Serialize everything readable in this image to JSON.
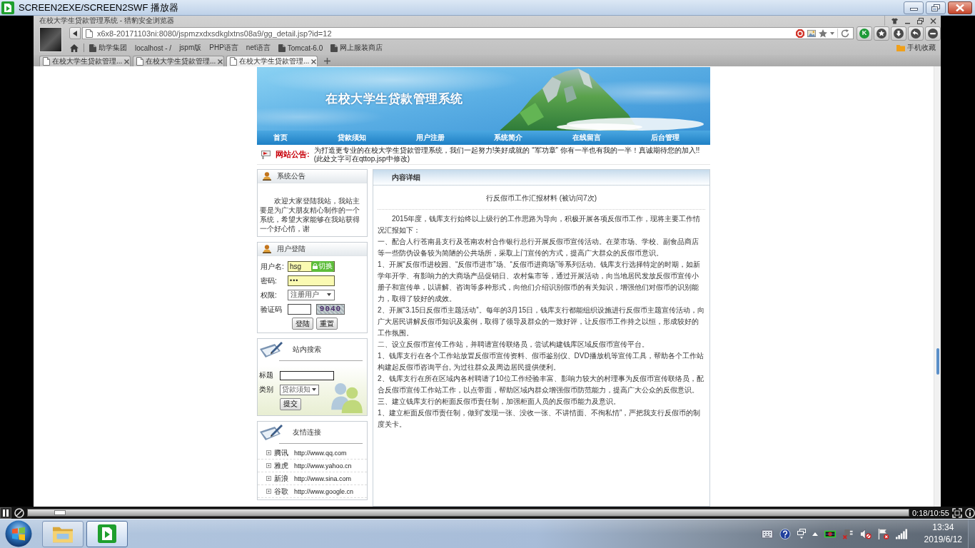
{
  "player": {
    "title": "SCREEN2EXE/SCREEN2SWF 播放器",
    "playing": true,
    "progress": {
      "level": 0.03
    },
    "time": "0:18/10:55"
  },
  "browser": {
    "title": "在校大学生贷款管理系统 - 猎豹安全浏览器",
    "url": "x6x8-20171103ni:8080/jspmzxdxsdkglxtns08a9/gg_detail.jsp?id=12",
    "extension": "K",
    "bookmarks": [
      {
        "label": "助学集团",
        "kind": "folder"
      },
      {
        "label": "localhost - /",
        "kind": "link"
      },
      {
        "label": "jspm版",
        "kind": "link"
      },
      {
        "label": "PHP语言",
        "kind": "link"
      },
      {
        "label": "net语言",
        "kind": "link"
      },
      {
        "label": "Tomcat-6.0",
        "kind": "folder"
      },
      {
        "label": "网上服装商店",
        "kind": "folder"
      }
    ],
    "mobile_bookmarks": "手机收藏",
    "tabs": [
      {
        "label": "在校大学生贷款管理...",
        "selected": false
      },
      {
        "label": "在校大学生贷款管理...",
        "selected": false
      },
      {
        "label": "在校大学生贷款管理...",
        "selected": true
      }
    ]
  },
  "site": {
    "title": "在校大学生贷款管理系统",
    "nav": [
      "首页",
      "贷款须知",
      "用户注册",
      "系统简介",
      "在线留言",
      "后台管理"
    ],
    "notice": {
      "label": "网站公告:",
      "text": "为打造更专业的在校大学生贷款管理系统，我们一起努力!美好成就的 “军功章” 你有一半也有我的一半！真诚期待您的加入!! (此处文字可在qttop.jsp中修改)"
    },
    "announcement": {
      "title": "系统公告",
      "text": "欢迎大家登陆我站，我站主要是为广大朋友精心制作的一个系统，希望大家能够在我站获得一个好心情，谢"
    },
    "login": {
      "title": "用户登陆",
      "fields": [
        {
          "label": "用户名:",
          "kind": "text",
          "value": "hsg",
          "autofilled": true,
          "switch": "切换"
        },
        {
          "label": "密码:",
          "kind": "password",
          "value": "•••",
          "autofilled": true
        },
        {
          "label": "权限:",
          "kind": "select",
          "value": "注册用户",
          "autofilled": false
        },
        {
          "label": "验证码",
          "kind": "captcha",
          "code": "9040",
          "autofilled": false
        }
      ],
      "buttons": [
        "登陆",
        "重置"
      ]
    },
    "search": {
      "title": "站内搜索",
      "fields": [
        {
          "label": "标题",
          "kind": "text"
        },
        {
          "label": "类别",
          "kind": "select",
          "value": "贷款须知"
        }
      ],
      "button": "提交"
    },
    "links": {
      "title": "友情连接",
      "items": [
        {
          "name": "腾讯",
          "url": "http://www.qq.com"
        },
        {
          "name": "雅虎",
          "url": "http://www.yahoo.cn"
        },
        {
          "name": "新浪",
          "url": "http://www.sina.com"
        },
        {
          "name": "谷歌",
          "url": "http://www.google.cn"
        }
      ]
    },
    "article": {
      "panel_title": "内容详细",
      "title": "行反假币工作汇报材料 (被访问7次)",
      "paragraphs": [
        "2015年度，钱库支行始终以上级行的工作思路为导向，积极开展各项反假币工作，现将主要工作情况汇报如下：",
        "一、配合人行苍南县支行及苍南农村合作银行总行开展反假币宣传活动。在菜市场、学校、副食品商店等一些防伪设备较为简陋的公共场所，采取上门宣传的方式，提高广大群众的反假币意识。",
        "1、开展“反假币进校园、“反假币进市”场、“反假币进商场”等系列活动。钱库支行选择特定的时期，如新学年开学、有影响力的大商场产品促销日、农村集市等，通过开展活动，向当地居民发放反假币宣传小册子和宣传单，以讲解、咨询等多种形式，向他们介绍识别假币的有关知识，增强他们对假币的识别能力，取得了较好的成效。",
        "2、开展“3.15日反假币主题活动”。每年的3月15日，钱库支行都能组织设施进行反假币主题宣传活动，向广大居民讲解反假币知识及案例，取得了领导及群众的一致好评，让反假币工作持之以恒，形成较好的工作氛围。",
        "二、设立反假币宣传工作站，并聘请宣传联络员，尝试构建钱库区域反假币宣传平台。",
        "1、钱库支行在各个工作站放置反假币宣传资料、假币鉴别仪、DVD播放机等宣传工具，帮助各个工作站构建起反假币咨询平台, 为过往群众及周边居民提供便利。",
        "2、钱库支行在所在区域内各村聘请了10位工作经验丰富、影响力较大的村理事为反假币宣传联络员，配合反假币宣传工作站工作，以点带面，帮助区域内群众增强假币防范能力，提高广大公众的反假意识。",
        "三、建立钱库支行的柜面反假币责任制，加强柜面人员的反假币能力及意识。",
        "1、建立柜面反假币责任制，做到“发现一张、没收一张、不讲情面、不徇私情”，严把我支行反假币的制度关卡。"
      ]
    }
  },
  "taskbar": {
    "apps": [
      {
        "kind": "explorer",
        "selected": false
      },
      {
        "kind": "player",
        "selected": true
      }
    ],
    "time": "13:34",
    "date": "2019/6/12"
  }
}
